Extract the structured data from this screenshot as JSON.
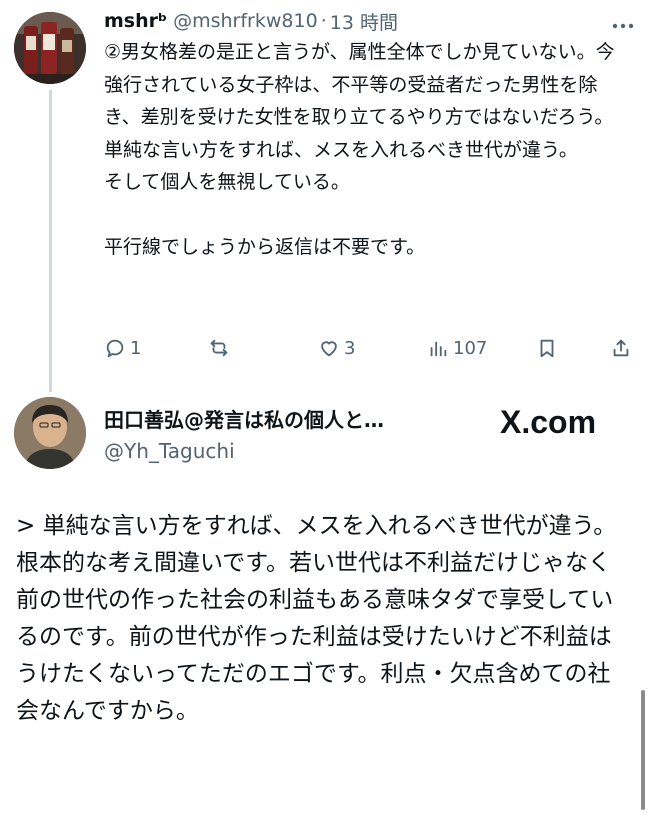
{
  "tweet": {
    "display_name": "mshrᵇ",
    "handle": "@mshrfrkw810",
    "separator": "·",
    "time": "13 時間",
    "more_icon": "more-icon",
    "text": "②男女格差の是正と言うが、属性全体でしか見ていない。今強行されている女子枠は、不平等の受益者だった男性を除き、差別を受けた女性を取り立てるやり方ではないだろう。\n単純な言い方をすれば、メスを入れるべき世代が違う。\nそして個人を無視している。\n\n平行線でしょうから返信は不要です。",
    "actions": {
      "reply_count": "1",
      "retweet_count": "",
      "like_count": "3",
      "view_count": "107"
    }
  },
  "quoted": {
    "display_name": "田口善弘@発言は私の個人と…",
    "handle": "@Yh_Taguchi",
    "brand": "X.com",
    "text": "> 単純な言い方をすれば、メスを入れるべき世代が違う。\n根本的な考え間違いです。若い世代は不利益だけじゃなく前の世代の作った社会の利益もある意味タダで享受しているのです。前の世代が作った利益は受けたいけど不利益はうけたくないってただのエゴです。利点・欠点含めての社会なんですから。"
  }
}
